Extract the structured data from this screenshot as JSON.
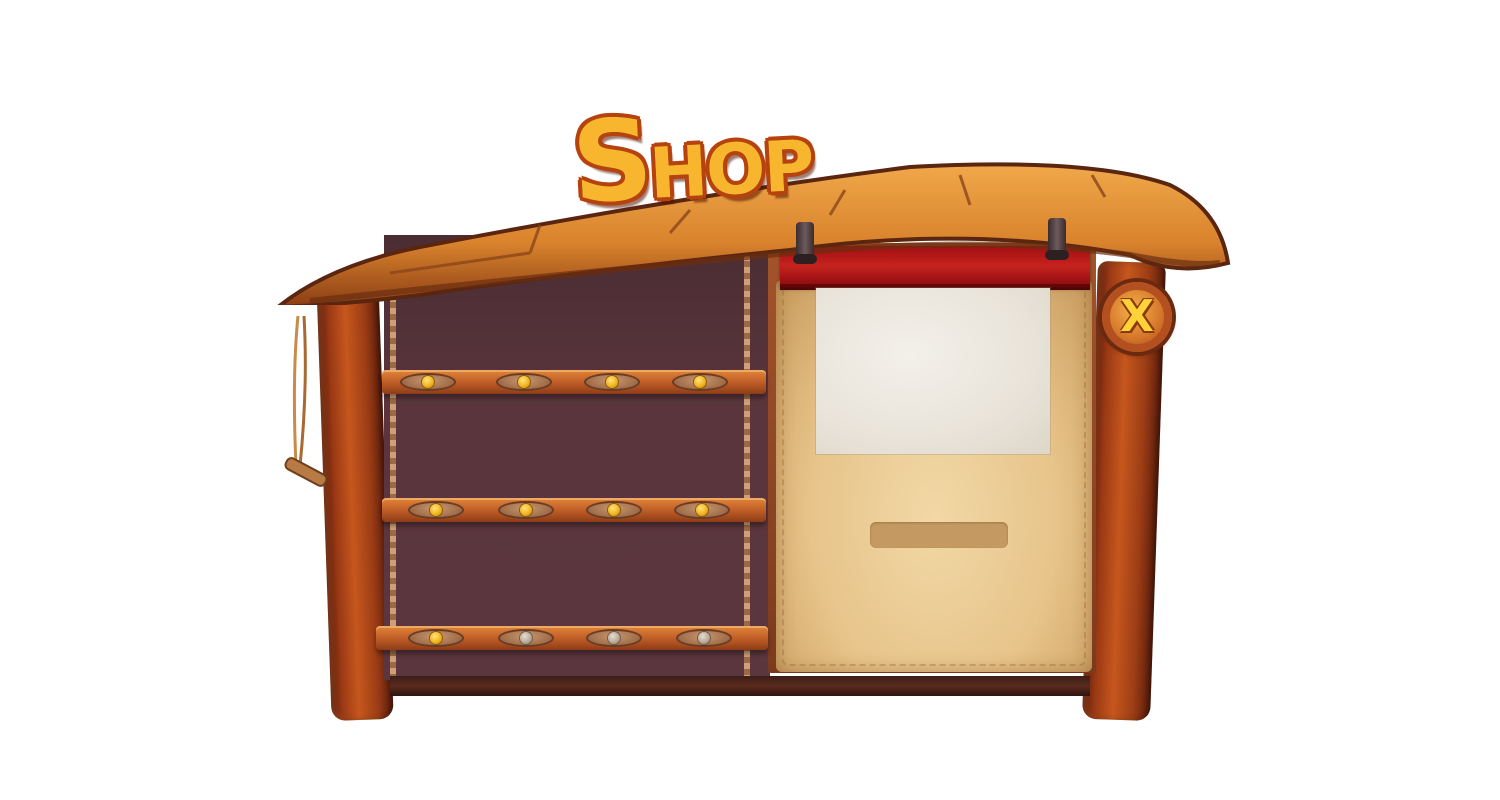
{
  "title": {
    "big": "S",
    "small": "HOP"
  },
  "close_button": {
    "label": "X",
    "icon": "close-icon"
  },
  "shelves": [
    {
      "name": "top-shelf",
      "slots": [
        "gold",
        "gold",
        "gold",
        "gold"
      ]
    },
    {
      "name": "middle-shelf",
      "slots": [
        "gold",
        "gold",
        "gold",
        "gold"
      ]
    },
    {
      "name": "bottom-shelf",
      "slots": [
        "gold",
        "silver",
        "silver",
        "silver"
      ]
    }
  ],
  "colors": {
    "title_fill": "#f7b62e",
    "title_outline": "#b8420e",
    "wall": "#5a353d",
    "banner": "#c6221e",
    "parchment": "#e7c48a"
  }
}
